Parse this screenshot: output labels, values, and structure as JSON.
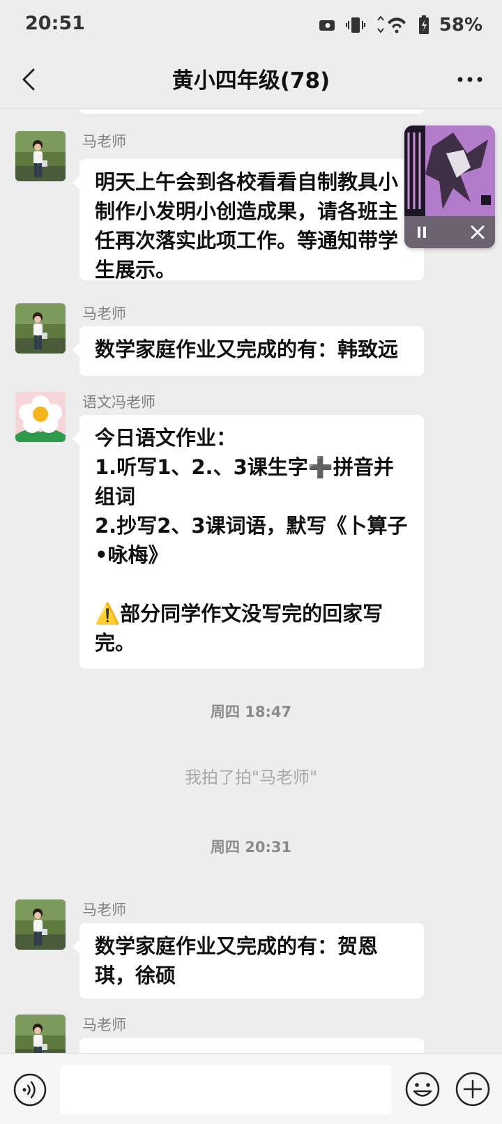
{
  "status_bar": {
    "time": "20:51",
    "battery": "58%"
  },
  "header": {
    "title": "黄小四年级(78)"
  },
  "messages": [
    {
      "sender": "马老师",
      "text": "明天上午会到各校看看自制教具小制作小发明小创造成果，请各班主任再次落实此项工作。等通知带学生展示。"
    },
    {
      "sender": "马老师",
      "text": "数学家庭作业又完成的有：韩致远"
    },
    {
      "sender": "语文冯老师",
      "text": "今日语文作业：\n1.听写1、2.、3课生字➕拼音并组词\n2.抄写2、3课词语，默写《卜算子•咏梅》\n\n⚠️部分同学作文没写完的回家写完。"
    },
    {
      "sender": "马老师",
      "text": "数学家庭作业又完成的有：贺恩琪，徐硕"
    },
    {
      "sender": "马老师",
      "text": ""
    }
  ],
  "timestamps": [
    "周四 18:47",
    "周四 20:31"
  ],
  "system_notice": "我拍了拍\"马老师\"",
  "colors": {
    "background": "#ededed",
    "bubble": "#ffffff",
    "meta_text": "#8a8a8a"
  },
  "icons": {
    "back": "chevron-left-icon",
    "more": "more-dots-icon",
    "voice": "voice-icon",
    "emoji": "emoji-icon",
    "plus": "plus-icon",
    "pause": "pause-icon",
    "close": "close-icon"
  }
}
